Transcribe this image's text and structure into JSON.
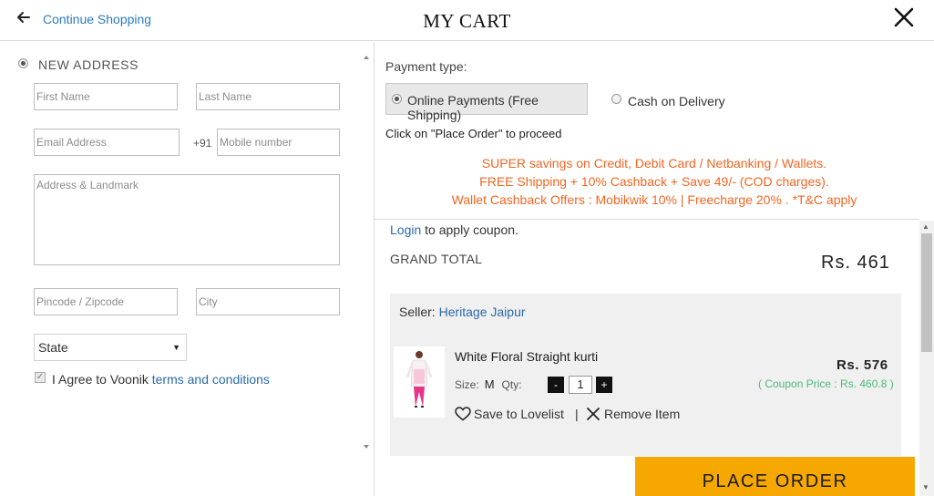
{
  "header": {
    "continue_label": "Continue Shopping",
    "title": "MY CART"
  },
  "address": {
    "section_label": "NEW ADDRESS",
    "first_name_placeholder": "First Name",
    "last_name_placeholder": "Last Name",
    "email_placeholder": "Email Address",
    "phone_prefix": "+91",
    "mobile_placeholder": "Mobile number",
    "address_placeholder": "Address & Landmark",
    "pincode_placeholder": "Pincode / Zipcode",
    "city_placeholder": "City",
    "state_selected": "State",
    "agree_prefix": "I Agree to Voonik",
    "agree_link": "terms and conditions"
  },
  "payment": {
    "label": "Payment type:",
    "options": [
      {
        "label": "Online Payments (Free Shipping)",
        "selected": true
      },
      {
        "label": "Cash on Delivery",
        "selected": false
      }
    ],
    "click_note": "Click on \"Place Order\" to proceed",
    "offers": [
      "SUPER savings on Credit, Debit Card / Netbanking / Wallets.",
      "FREE Shipping + 10% Cashback + Save 49/- (COD charges).",
      "Wallet Cashback Offers : Mobikwik 10% | Freecharge 20% . *T&C apply"
    ],
    "offer_color": "#f26522"
  },
  "cart": {
    "coupon_link": "Login",
    "coupon_text": "to apply coupon.",
    "grand_total_label": "GRAND TOTAL",
    "grand_total_value": "Rs. 461",
    "seller_label": "Seller:",
    "seller_name": "Heritage Jaipur",
    "item": {
      "name": "White Floral Straight kurti",
      "size_label": "Size:",
      "size_value": "M",
      "qty_label": "Qty:",
      "qty_value": "1",
      "minus": "-",
      "plus": "+",
      "price": "Rs. 576",
      "coupon_price": "( Coupon Price : Rs. 460.8 )",
      "save_label": "Save to Lovelist",
      "separator": "|",
      "remove_label": "Remove Item"
    },
    "place_order_label": "PLACE ORDER",
    "accent_color": "#f7a800"
  }
}
